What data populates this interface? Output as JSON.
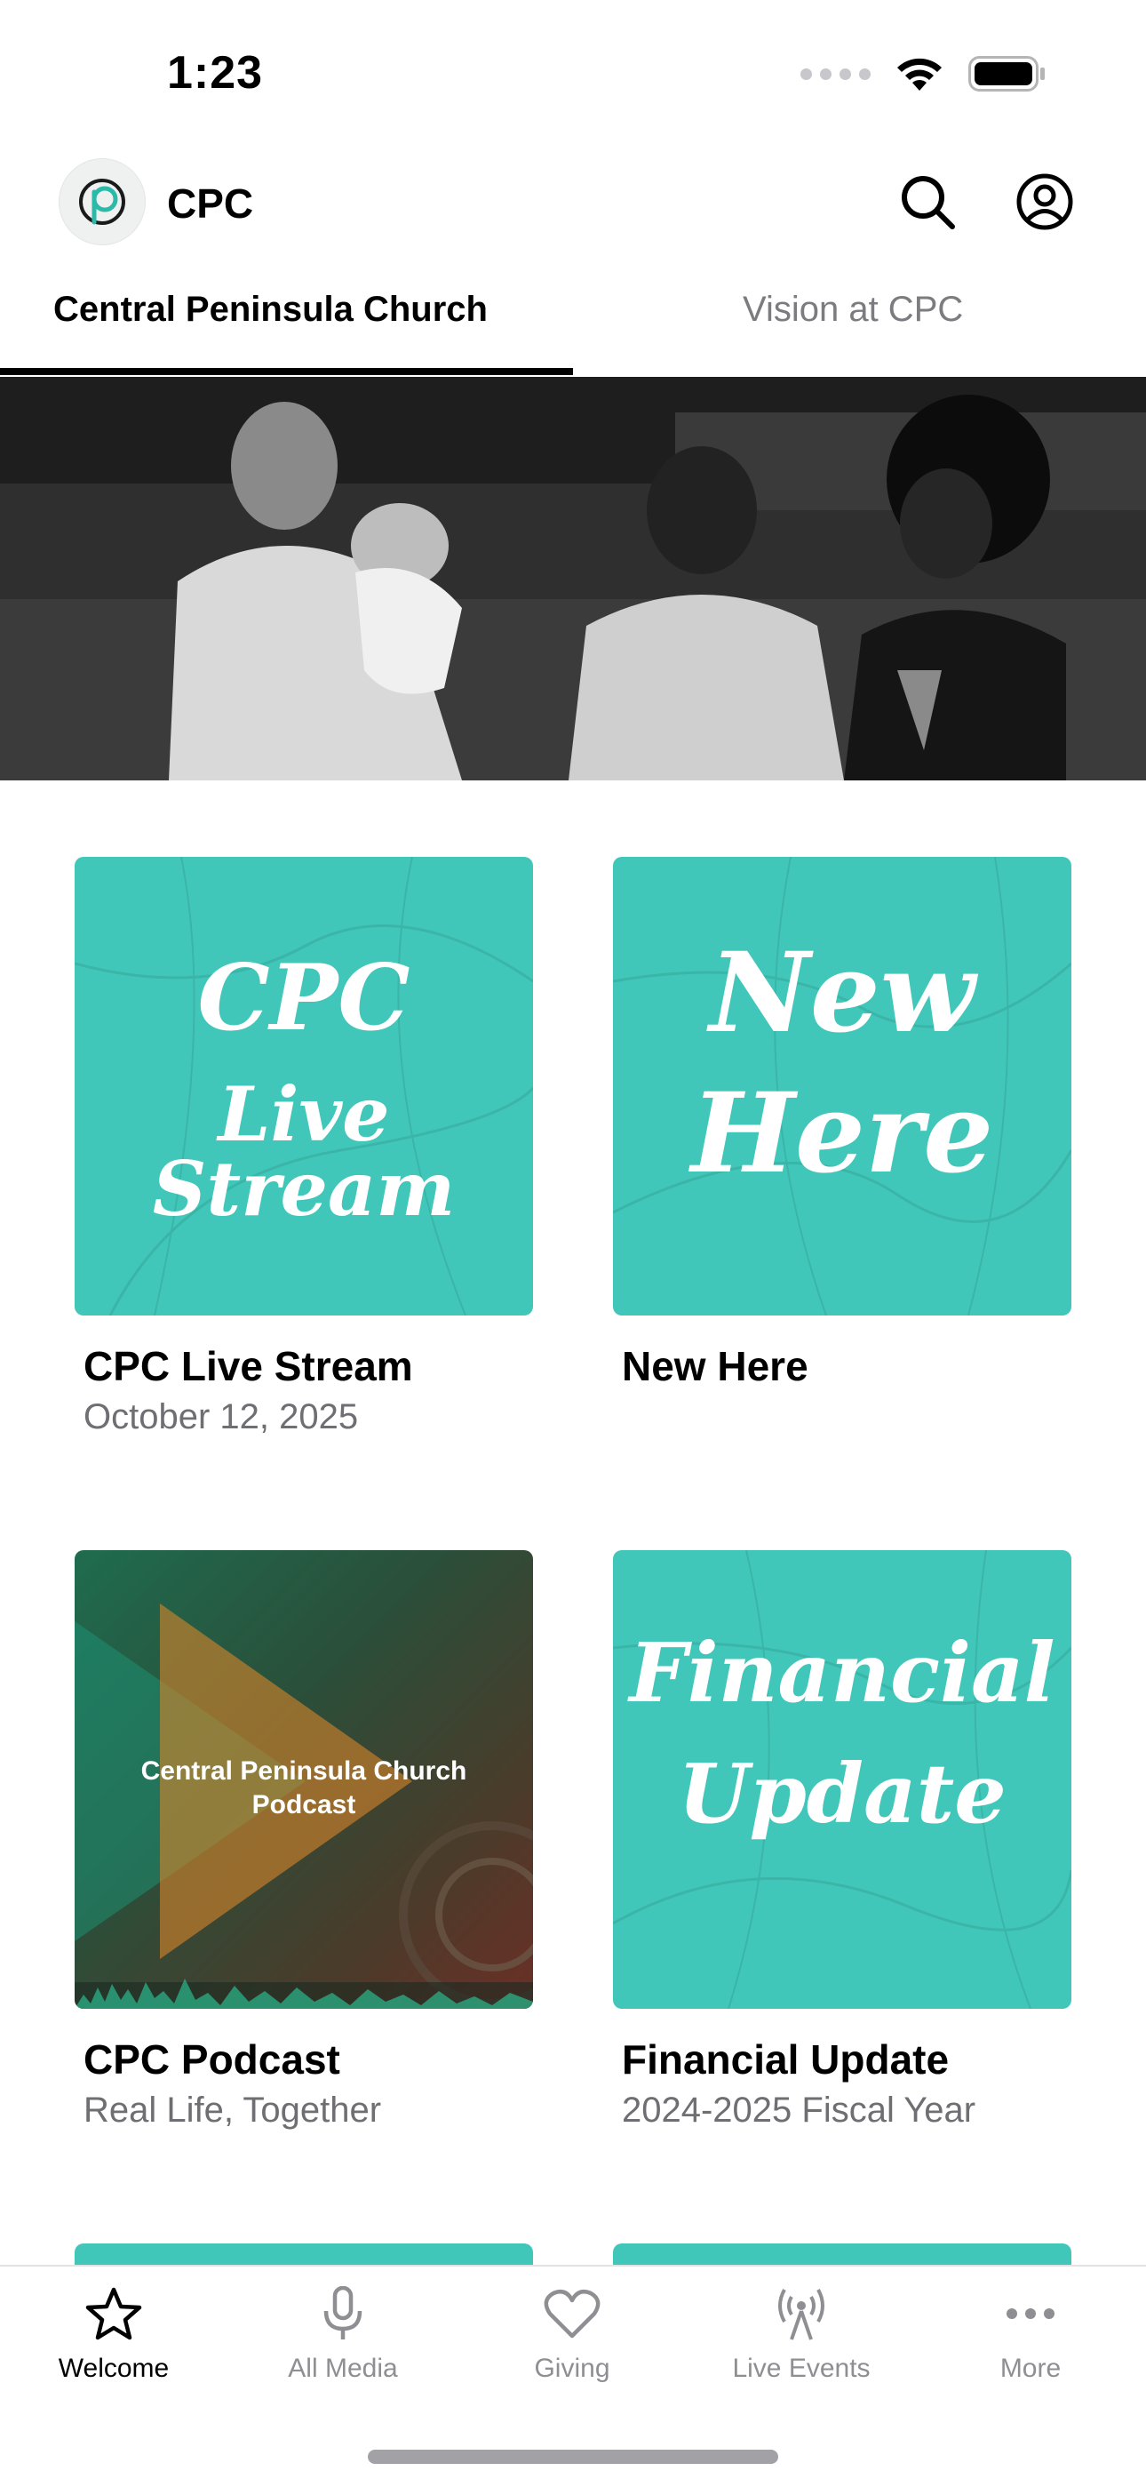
{
  "status_bar": {
    "time": "1:23"
  },
  "header": {
    "title": "CPC"
  },
  "tabs": [
    {
      "label": "Central Peninsula Church",
      "active": true
    },
    {
      "label": "Vision at CPC",
      "active": false
    }
  ],
  "cards": [
    {
      "artwork_text": [
        "CPC",
        "Live Stream"
      ],
      "title": "CPC Live Stream",
      "subtitle": "October 12, 2025"
    },
    {
      "artwork_text": [
        "New",
        "Here"
      ],
      "title": "New Here",
      "subtitle": ""
    },
    {
      "artwork_text": [
        "Central Peninsula Church",
        "Podcast"
      ],
      "title": "CPC Podcast",
      "subtitle": "Real Life, Together"
    },
    {
      "artwork_text": [
        "Financial",
        "Update"
      ],
      "title": "Financial Update",
      "subtitle": "2024-2025 Fiscal Year"
    }
  ],
  "tabbar": [
    {
      "label": "Welcome",
      "icon": "star-icon",
      "active": true
    },
    {
      "label": "All Media",
      "icon": "microphone-icon",
      "active": false
    },
    {
      "label": "Giving",
      "icon": "heart-icon",
      "active": false
    },
    {
      "label": "Live Events",
      "icon": "broadcast-icon",
      "active": false
    },
    {
      "label": "More",
      "icon": "ellipsis-icon",
      "active": false
    }
  ],
  "colors": {
    "accent_teal": "#41c7b9",
    "inactive_gray": "#8e8e93",
    "subtitle_gray": "#6e6e73"
  }
}
